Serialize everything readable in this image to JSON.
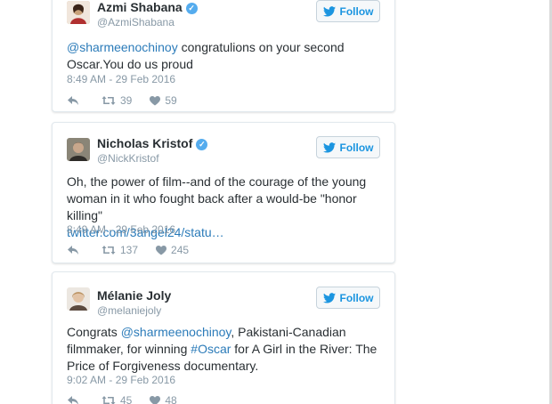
{
  "tweets": [
    {
      "name": "Azmi Shabana",
      "handle": "@AzmiShabana",
      "follow_label": "Follow",
      "text_parts": [
        {
          "t": "@sharmeenochinoy",
          "link": true
        },
        {
          "t": " congratulions on your second Oscar.You do us proud",
          "link": false
        }
      ],
      "time": "8:49 AM - 29 Feb 2016",
      "retweets": "39",
      "likes": "59",
      "avatar_color": "#c9a27a"
    },
    {
      "name": "Nicholas Kristof",
      "handle": "@NickKristof",
      "follow_label": "Follow",
      "text_parts": [
        {
          "t": "Oh, the power of film--and of the courage of the young woman in it who fought back after a would-be \"honor killing\"",
          "link": false
        }
      ],
      "link_line": "twitter.com/3angel24/statu…",
      "time": "8:49 AM - 29 Feb 2016",
      "retweets": "137",
      "likes": "245",
      "avatar_color": "#6d6a5f"
    },
    {
      "name": "Mélanie Joly",
      "handle": "@melaniejoly",
      "follow_label": "Follow",
      "text_parts": [
        {
          "t": "Congrats ",
          "link": false
        },
        {
          "t": "@sharmeenochinoy",
          "link": true
        },
        {
          "t": ", Pakistani-Canadian filmmaker, for winning ",
          "link": false
        },
        {
          "t": "#Oscar",
          "link": true
        },
        {
          "t": " for A Girl in the River: The Price of Forgiveness documentary.",
          "link": false
        }
      ],
      "time": "9:02 AM - 29 Feb 2016",
      "retweets": "45",
      "likes": "48",
      "avatar_color": "#d8c2a8"
    }
  ],
  "colors": {
    "link": "#2b7bb9",
    "verified": "#55acee",
    "follow_text": "#1b95e0",
    "muted": "#8899a6"
  },
  "icons": [
    "verified-badge-icon",
    "twitter-bird-icon",
    "reply-icon",
    "retweet-icon",
    "like-heart-icon"
  ]
}
